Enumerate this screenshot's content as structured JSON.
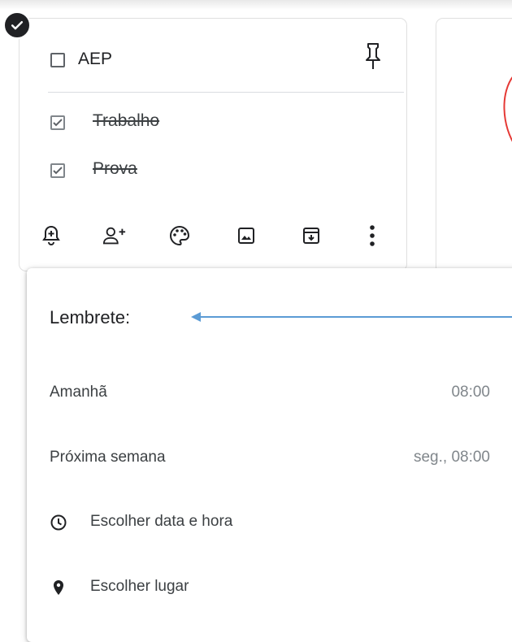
{
  "note": {
    "title": "AEP",
    "checked_items": [
      "Trabalho",
      "Prova"
    ]
  },
  "toolbar": {
    "icons": [
      "remind-me-icon",
      "collaborator-icon",
      "palette-icon",
      "image-icon",
      "archive-icon",
      "more-icon"
    ]
  },
  "reminder_menu": {
    "title": "Lembrete:",
    "tomorrow": {
      "label": "Amanhã",
      "time": "08:00"
    },
    "next_week": {
      "label": "Próxima semana",
      "time": "seg., 08:00"
    },
    "pick_date": {
      "label": "Escolher data e hora"
    },
    "pick_place": {
      "label": "Escolher lugar"
    }
  },
  "colors": {
    "arrow": "#5b9bd5",
    "accent_red": "#e53935"
  }
}
